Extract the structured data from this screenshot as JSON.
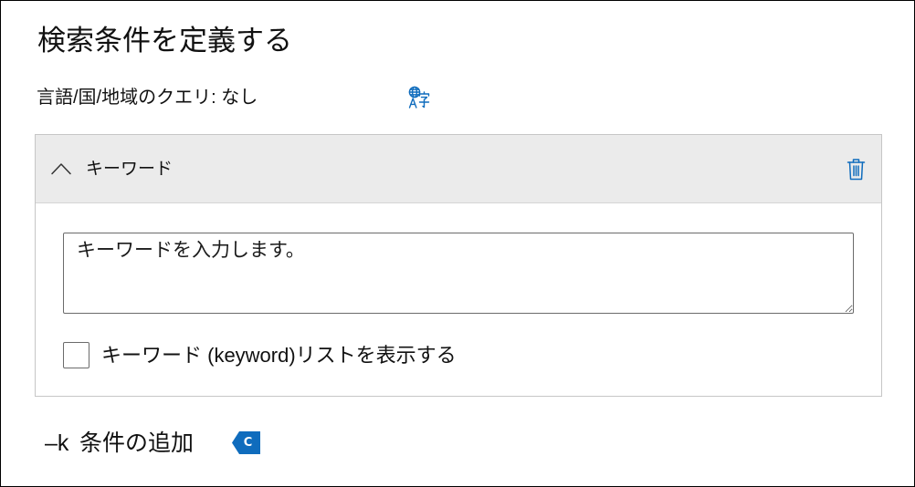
{
  "page_title": "検索条件を定義する",
  "query": {
    "label": "言語/国/地域のクエリ: なし",
    "icon": "translate-icon"
  },
  "keyword_section": {
    "title": "キーワード",
    "expanded": true,
    "collapse_icon": "chevron-up-icon",
    "delete_icon": "trash-icon",
    "input": {
      "placeholder": "キーワードを入力します。"
    },
    "show_list": {
      "label": "キーワード (keyword)リストを表示する",
      "checked": false
    }
  },
  "add_condition": {
    "prefix": "–k",
    "label": "条件の追加",
    "badge": "C"
  },
  "colors": {
    "accent": "#0f6cbd",
    "header_background": "#ebebeb",
    "section_border": "#c6c6c6"
  }
}
